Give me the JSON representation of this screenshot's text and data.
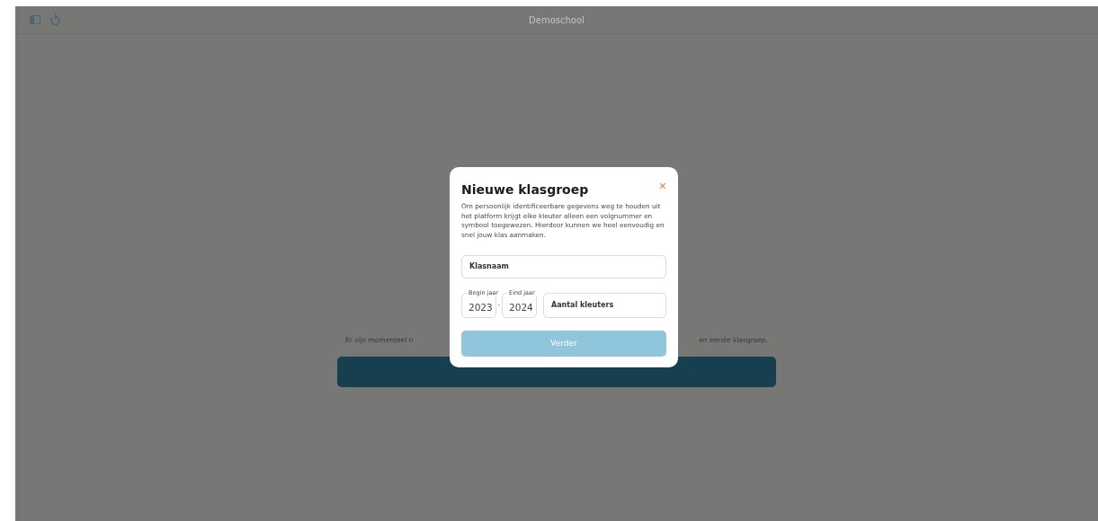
{
  "header": {
    "title": "Demoschool"
  },
  "background": {
    "message_start": "Er zijn momenteel n",
    "message_end": "en eerste klasgroep."
  },
  "dialog": {
    "title": "Nieuwe klasgroep",
    "close": "×",
    "description": "Om persoonlijk identificeerbare gegevens weg te houden uit het platform krijgt elke kleuter alleen een volgnummer en symbool toegewezen. Hierdoor kunnen we heel eenvoudig en snel jouw klas aanmaken.",
    "class_name": {
      "placeholder": "Klasnaam"
    },
    "start_year": {
      "label": "Begin jaar",
      "value": "2023"
    },
    "separator": "-",
    "end_year": {
      "label": "Eind jaar",
      "value": "2024"
    },
    "children_count": {
      "placeholder": "Aantal kleuters"
    },
    "submit": {
      "label": "Verder",
      "disabled": true
    }
  }
}
